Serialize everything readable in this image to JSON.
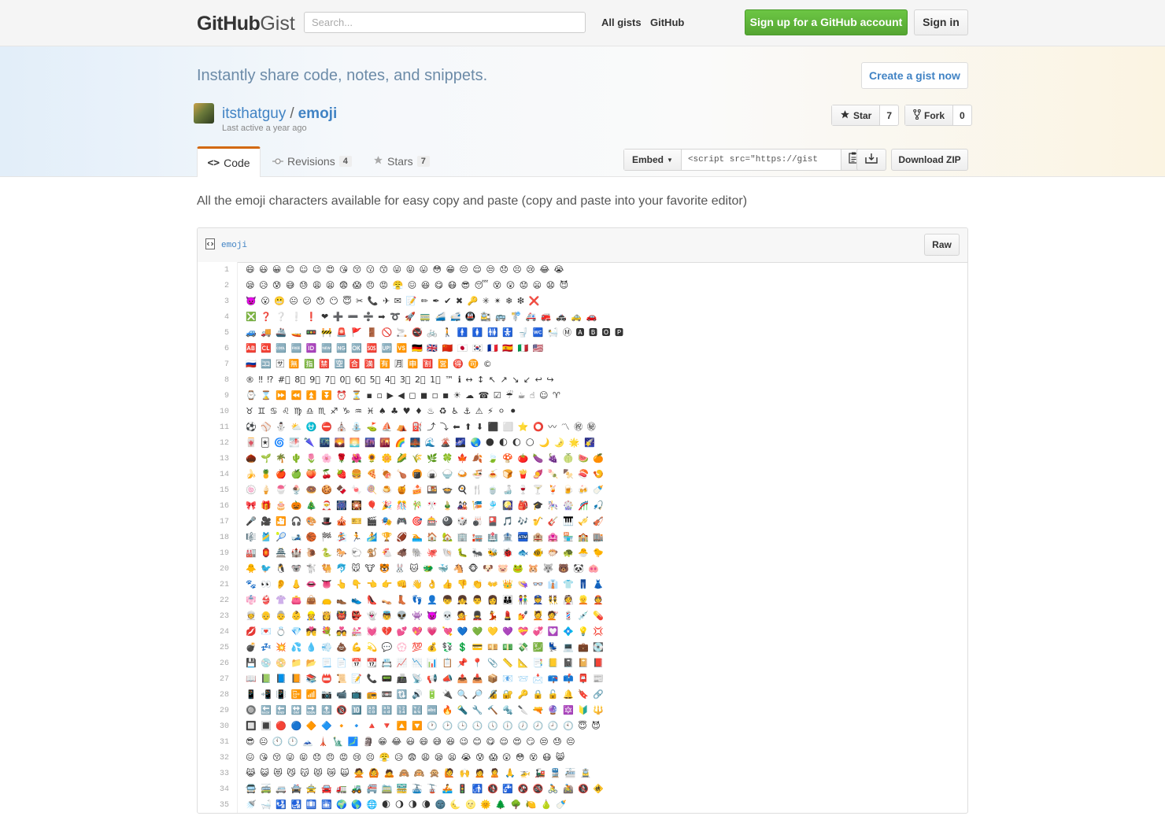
{
  "header": {
    "logo_bold": "GitHub",
    "logo_light": "Gist",
    "search_placeholder": "Search...",
    "nav": [
      "All gists",
      "GitHub"
    ],
    "signup_label": "Sign up for a GitHub account",
    "signin_label": "Sign in"
  },
  "hero": {
    "tagline": "Instantly share code, notes, and snippets.",
    "create_label": "Create a gist now"
  },
  "gist": {
    "owner": "itsthatguy",
    "separator": "/",
    "name": "emoji",
    "last_active": "Last active a year ago",
    "star_label": "Star",
    "star_count": "7",
    "fork_label": "Fork",
    "fork_count": "0",
    "description": "All the emoji characters available for easy copy and paste (copy and paste into your favorite editor)"
  },
  "tabs": [
    {
      "label": "Code",
      "count": ""
    },
    {
      "label": "Revisions",
      "count": "4"
    },
    {
      "label": "Stars",
      "count": "7"
    }
  ],
  "embed": {
    "label": "Embed",
    "value": "<script src=\"https://gist"
  },
  "download_zip": "Download ZIP",
  "file": {
    "name": "emoji",
    "raw_label": "Raw",
    "lines": [
      "😄 😃 😀 😊 ☺ 😉 😍 😘 😚 😗 😙 😜 😝 😛 😳 😁 😔 😌 😒 😞 😣 😢 😂 😭",
      "😪 😥 😰 😅 😓 😩 😫 😨 😱 😠 😡 😤 😖 😆 😋 😷 😎 😴 😵 😲 😟 😦 😧 😈",
      "👿 😮 😬 😐 😕 😯 😶 😇 ✂ 📞 ✈ ✉ 📝 ✏ ✒ ✔ ✖ 🔑 ✳ ✴ ❄ ❇ ❌",
      "❎ ❓ ❔ ❕ ❗ ❤ ➕ ➖ ➗ ➡ ➰ 🚀 🚃 🚄 🚅 🚇 🚉 🚌 🚏 🚑 🚒 🚓 🚕 🚗",
      "🚙 🚚 🚢 🚤 🚥 🚧 🚨 🚩 🚪 🚫 🚬 🚭 🚲 🚶 🚹 🚺 🚻 🚼 🚽 🚾 🛀 Ⓜ 🅰 🅱 🅾 🅿",
      "🆎 🆑 🆒 🆓 🆔 🆕 🆖 🆗 🆘 🆙 🆚 🇩🇪 🇬🇧 🇨🇳 🇯🇵 🇰🇷 🇫🇷 🇪🇸 🇮🇹 🇺🇸",
      "🇷🇺 🈁 🈂 🈚 🈯 🈲 🈳 🈴 🈵 🈶 🈷 🈸 🈹 🈺 🉐 🉑 ©",
      "® ‼ ⁉ #⃣ 8⃣ 9⃣ 7⃣ 0⃣ 6⃣ 5⃣ 4⃣ 3⃣ 2⃣ 1⃣ ™ ℹ ↔ ↕ ↖ ↗ ↘ ↙ ↩ ↪",
      "⌚ ⌛ ⏩ ⏪ ⏫ ⏬ ⏰ ⏳ ▪ ▫ ▶ ◀ ◻ ◼ ◽ ◾ ☀ ☁ ☎ ☑ ☔ ☕ ☝ ☺ ♈",
      "♉ ♊ ♋ ♌ ♍ ♎ ♏ ♐ ♑ ♒ ♓ ♠ ♣ ♥ ♦ ♨ ♻ ♿ ⚓ ⚠ ⚡ ⚪ ⚫",
      "⚽ ⚾ ⛄ ⛅ ⛎ ⛔ ⛪ ⛲ ⛳ ⛵ ⛺ ⛽ ⤴ ⤵ ⬅ ⬆ ⬇ ⬛ ⬜ ⭐ ⭕ 〰 〽 ㊗ ㊙",
      "🀄 🃏 🌀 🌁 🌂 🌃 🌄 🌅 🌆 🌇 🌈 🌉 🌊 🌋 🌌 🌏 🌑 🌓 🌔 🌕 🌙 🌛 🌟 🌠",
      "🌰 🌱 🌴 🌵 🌷 🌸 🌹 🌺 🌻 🌼 🌽 🌾 🌿 🍀 🍁 🍂 🍃 🍄 🍅 🍆 🍇 🍈 🍉 🍊",
      "🍌 🍍 🍎 🍏 🍑 🍒 🍓 🍔 🍕 🍖 🍗 🍘 🍙 🍚 🍛 🍜 🍝 🍞 🍟 🍠 🍡 🍢 🍣 🍤",
      "🍥 🍦 🍧 🍨 🍩 🍪 🍫 🍬 🍭 🍮 🍯 🍰 🍱 🍲 🍳 🍴 🍵 🍶 🍷 🍸 🍹 🍺 🍻 🍼",
      "🎀 🎁 🎂 🎃 🎄 🎅 🎆 🎇 🎈 🎉 🎊 🎋 🎌 🎍 🎎 🎏 🎐 🎑 🎒 🎓 🎠 🎡 🎢 🎣",
      "🎤 🎥 🎦 🎧 🎨 🎩 🎪 🎫 🎬 🎭 🎮 🎯 🎰 🎱 🎲 🎳 🎴 🎵 🎶 🎷 🎸 🎹 🎺 🎻",
      "🎼 🎽 🎾 🎿 🏀 🏁 🏂 🏃 🏄 🏆 🏈 🏊 🏠 🏡 🏢 🏣 🏥 🏦 🏧 🏨 🏩 🏪 🏫 🏬",
      "🏭 🏮 🏯 🏰 🐌 🐍 🐎 🐑 🐒 🐔 🐗 🐘 🐙 🐚 🐛 🐜 🐝 🐞 🐟 🐠 🐡 🐢 🐣 🐤",
      "🐥 🐦 🐧 🐨 🐩 🐫 🐬 🐭 🐮 🐯 🐰 🐱 🐲 🐳 🐴 🐵 🐶 🐷 🐸 🐹 🐺 🐻 🐼 🐽",
      "🐾 👀 👂 👃 👄 👅 👆 👇 👈 👉 👊 👋 👌 👍 👎 👏 👐 👑 👒 👓 👔 👕 👖 👗",
      "👘 👙 👚 👛 👜 👝 👞 👟 👠 👡 👢 👣 👤 👦 👧 👨 👩 👪 👫 👮 👯 👰 👱 👲",
      "👳 👴 👵 👶 👷 👸 👹 👺 👻 👼 👽 👾 👿 💀 💁 💂 💃 💄 💅 💆 💇 💈 💉 💊",
      "💋 💌 💍 💎 💏 💐 💑 💒 💓 💔 💕 💖 💗 💘 💙 💚 💛 💜 💝 💞 💟 💠 💡 💢",
      "💣 💤 💥 💦 💧 💨 💩 💪 💫 💬 💮 💯 💰 💱 💲 💳 💴 💵 💸 💹 💺 💻 💼 💽",
      "💾 💿 📀 📁 📂 📃 📄 📅 📆 📇 📈 📉 📊 📋 📌 📍 📎 📏 📐 📑 📒 📓 📔 📕",
      "📖 📗 📘 📙 📚 📛 📜 📝 📞 📟 📠 📡 📢 📣 📤 📥 📦 📧 📨 📩 📪 📫 📮 📰",
      "📱 📲 📳 📴 📶 📷 📹 📺 📻 📼 🔃 🔊 🔋 🔌 🔍 🔎 🔏 🔐 🔑 🔒 🔓 🔔 🔖 🔗",
      "🔘 🔙 🔚 🔛 🔜 🔝 🔞 🔟 🔠 🔡 🔢 🔣 🔤 🔥 🔦 🔧 🔨 🔩 🔪 🔫 🔮 🔯 🔰 🔱",
      "🔲 🔳 🔴 🔵 🔶 🔷 🔸 🔹 🔺 🔻 🔼 🔽 🕐 🕑 🕒 🕓 🕔 🕕 🕖 🕗 🕘 🕙 😇 😈",
      "😎 😐 🕚 🕛 🗻 🗼 🗽 🗾 🗿 😁 😂 😃 😄 😅 😆 😉 😊 😋 😌 😍 😏 😒 😓 😔",
      "😖 😘 😚 😜 😝 😞 😠 😡 😢 😣 😤 😥 😨 😩 😪 😫 😭 😰 😱 😲 😳 😵 😷 😸",
      "😹 😺 😻 😼 😽 😾 😿 🙀 🙅 🙆 🙇 🙈 🙉 🙊 🙋 🙌 🙍 🙎 🙏 🚁 🚂 🚆 🚈 🚊",
      "🚍 🚎 🚐 🚔 🚖 🚘 🚛 🚜 🚝 🚞 🚟 🚠 🚡 🚣 🚦 🚮 🚯 🚰 🚱 🚳 🚴 🚵 🚷 🚸",
      "🚿 🛁 🛂 🛃 🛄 🛅 🌍 🌎 🌐 🌒 🌖 🌗 🌘 🌚 🌜 🌝 🌞 🌲 🌳 🍋 🍐 🍼"
    ]
  }
}
